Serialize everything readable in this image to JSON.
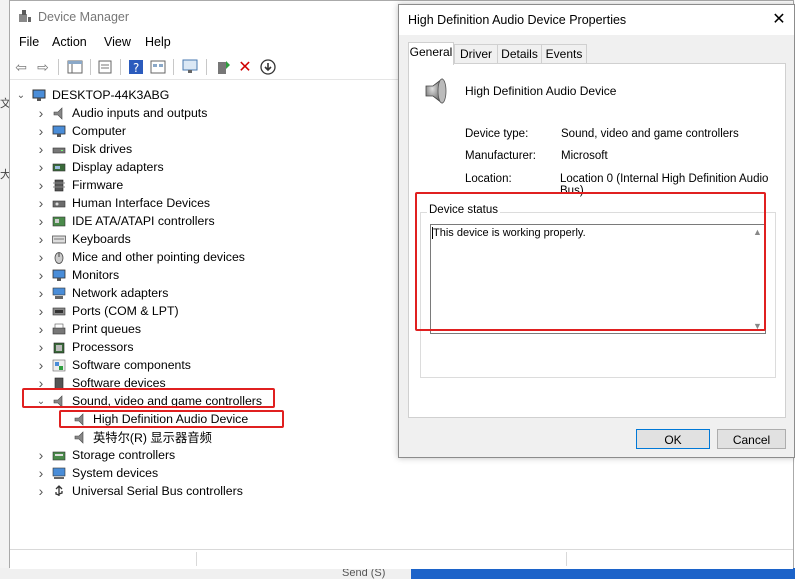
{
  "device_manager": {
    "title": "Device Manager",
    "menu": [
      "File",
      "Action",
      "View",
      "Help"
    ],
    "root": "DESKTOP-44K3ABG",
    "categories": [
      {
        "label": "Audio inputs and outputs",
        "icon": "audio-speaker-icon"
      },
      {
        "label": "Computer",
        "icon": "monitor-icon"
      },
      {
        "label": "Disk drives",
        "icon": "disk-drive-icon"
      },
      {
        "label": "Display adapters",
        "icon": "display-adapter-icon"
      },
      {
        "label": "Firmware",
        "icon": "firmware-chip-icon"
      },
      {
        "label": "Human Interface Devices",
        "icon": "hid-icon"
      },
      {
        "label": "IDE ATA/ATAPI controllers",
        "icon": "ide-controller-icon"
      },
      {
        "label": "Keyboards",
        "icon": "keyboard-icon"
      },
      {
        "label": "Mice and other pointing devices",
        "icon": "mouse-icon"
      },
      {
        "label": "Monitors",
        "icon": "monitor-icon"
      },
      {
        "label": "Network adapters",
        "icon": "network-adapter-icon"
      },
      {
        "label": "Ports (COM & LPT)",
        "icon": "port-icon"
      },
      {
        "label": "Print queues",
        "icon": "printer-icon"
      },
      {
        "label": "Processors",
        "icon": "processor-icon"
      },
      {
        "label": "Software components",
        "icon": "software-component-icon"
      },
      {
        "label": "Software devices",
        "icon": "software-device-icon"
      },
      {
        "label": "Sound, video and game controllers",
        "icon": "audio-speaker-icon",
        "expanded": true
      },
      {
        "label": "High Definition Audio Device",
        "icon": "audio-speaker-icon",
        "child": true
      },
      {
        "label": "英特尔(R) 显示器音频",
        "icon": "audio-speaker-icon",
        "child": true
      },
      {
        "label": "Storage controllers",
        "icon": "storage-controller-icon"
      },
      {
        "label": "System devices",
        "icon": "system-device-icon"
      },
      {
        "label": "Universal Serial Bus controllers",
        "icon": "usb-icon"
      }
    ]
  },
  "dialog": {
    "title": "High Definition Audio Device Properties",
    "tabs": [
      "General",
      "Driver",
      "Details",
      "Events"
    ],
    "device_name": "High Definition Audio Device",
    "device_type_label": "Device type:",
    "device_type": "Sound, video and game controllers",
    "manufacturer_label": "Manufacturer:",
    "manufacturer": "Microsoft",
    "location_label": "Location:",
    "location": "Location 0 (Internal High Definition Audio Bus)",
    "status_group": "Device status",
    "status_text": "This device is working properly.",
    "ok": "OK",
    "cancel": "Cancel"
  },
  "background": {
    "send_text": "Send (S)",
    "left_glyphs": [
      "文",
      "大"
    ]
  },
  "colors": {
    "highlight": "#e02020",
    "focus": "#0078d7",
    "taskbar": "#1c63c9"
  }
}
